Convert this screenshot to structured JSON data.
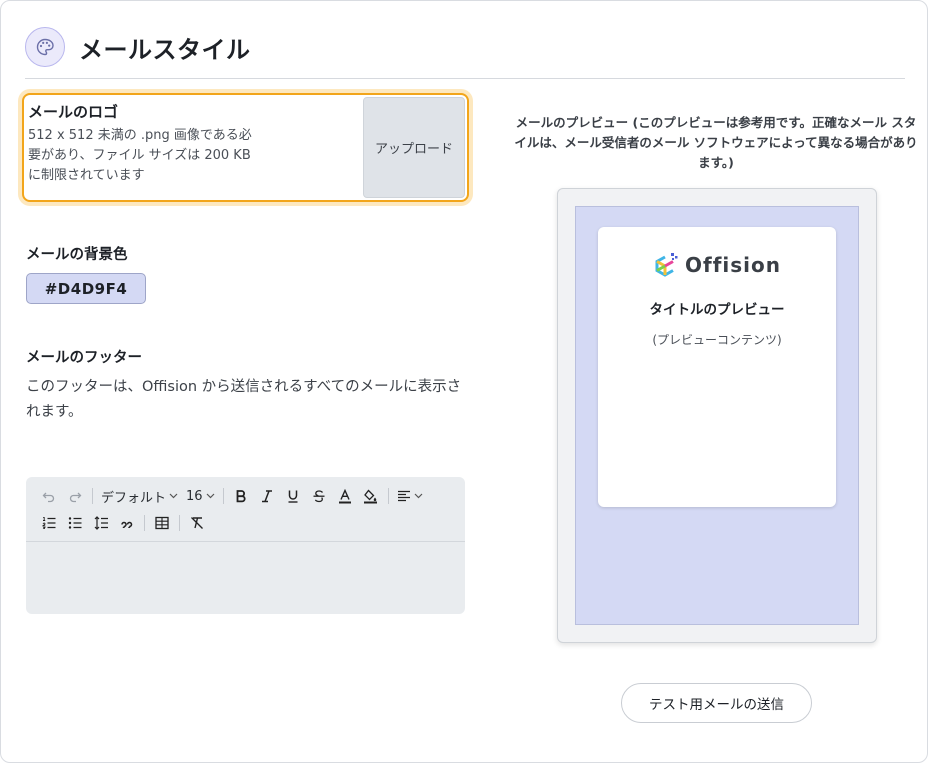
{
  "header": {
    "title": "メールスタイル",
    "icon": "palette-icon"
  },
  "logo": {
    "title": "メールのロゴ",
    "description": "512 x 512 未満の .png 画像である必要があり、ファイル サイズは 200 KB に制限されています",
    "upload_label": "アップロード"
  },
  "background_color": {
    "label": "メールの背景色",
    "value": "#D4D9F4"
  },
  "footer": {
    "label": "メールのフッター",
    "description": "このフッターは、Offision から送信されるすべてのメールに表示されます。"
  },
  "editor": {
    "font_family": "デフォルト",
    "font_size": "16",
    "content": ""
  },
  "preview": {
    "caption": "メールのプレビュー (このプレビューは参考用です。正確なメール スタイルは、メール受信者のメール ソフトウェアによって異なる場合があります。)",
    "brand_name": "Offision",
    "title": "タイトルのプレビュー",
    "content": "(プレビューコンテンツ)"
  },
  "actions": {
    "send_test_label": "テスト用メールの送信"
  },
  "colors": {
    "accent_border": "#F2A51A",
    "background": "#D4D9F4",
    "header_icon_bg": "#EBEAFB"
  }
}
